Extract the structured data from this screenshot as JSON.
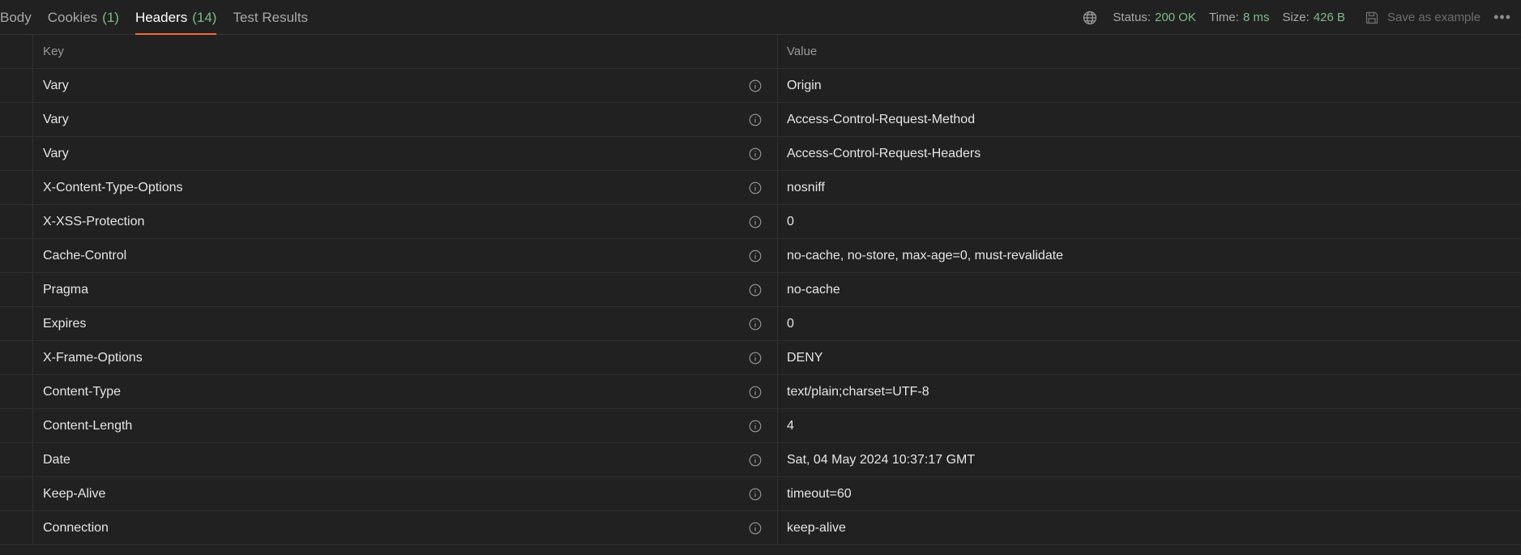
{
  "tabs": [
    {
      "label": "Body",
      "count": ""
    },
    {
      "label": "Cookies",
      "count": "(1)"
    },
    {
      "label": "Headers",
      "count": "(14)"
    },
    {
      "label": "Test Results",
      "count": ""
    }
  ],
  "status": {
    "status_label": "Status:",
    "status_value": "200 OK",
    "time_label": "Time:",
    "time_value": "8 ms",
    "size_label": "Size:",
    "size_value": "426 B",
    "save_label": "Save as example",
    "more": "•••"
  },
  "table": {
    "key_header": "Key",
    "value_header": "Value",
    "rows": [
      {
        "key": "Vary",
        "value": "Origin"
      },
      {
        "key": "Vary",
        "value": "Access-Control-Request-Method"
      },
      {
        "key": "Vary",
        "value": "Access-Control-Request-Headers"
      },
      {
        "key": "X-Content-Type-Options",
        "value": "nosniff"
      },
      {
        "key": "X-XSS-Protection",
        "value": "0"
      },
      {
        "key": "Cache-Control",
        "value": "no-cache, no-store, max-age=0, must-revalidate"
      },
      {
        "key": "Pragma",
        "value": "no-cache"
      },
      {
        "key": "Expires",
        "value": "0"
      },
      {
        "key": "X-Frame-Options",
        "value": "DENY"
      },
      {
        "key": "Content-Type",
        "value": "text/plain;charset=UTF-8"
      },
      {
        "key": "Content-Length",
        "value": "4"
      },
      {
        "key": "Date",
        "value": "Sat, 04 May 2024 10:37:17 GMT"
      },
      {
        "key": "Keep-Alive",
        "value": "timeout=60"
      },
      {
        "key": "Connection",
        "value": "keep-alive"
      }
    ]
  },
  "colors": {
    "background": "#212121",
    "accent": "#f26b3a",
    "success": "#7fb989"
  },
  "icons": {
    "globe": "globe-icon",
    "save": "save-icon",
    "info": "info-icon",
    "more": "more-options-icon"
  }
}
